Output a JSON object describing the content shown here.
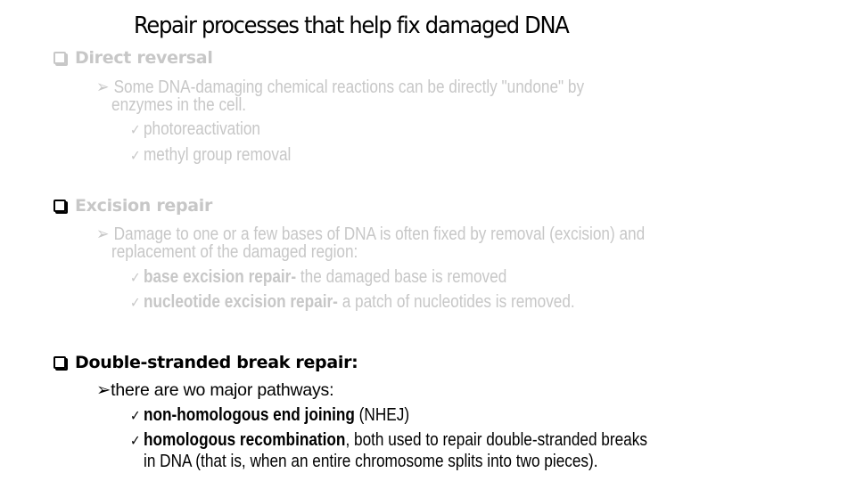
{
  "title": "Repair processes that help fix damaged DNA",
  "sections": [
    {
      "heading": "Direct reversal",
      "bullet": {
        "line1": "Some DNA-damaging chemical reactions can be directly \"undone\" by",
        "line2": "enzymes in the cell."
      },
      "items": [
        {
          "text": "photoreactivation"
        },
        {
          "text": "methyl group removal"
        }
      ]
    },
    {
      "heading": "Excision repair",
      "bullet": {
        "line1": "Damage to one or a few bases of DNA is often fixed by removal (excision) and",
        "line2": "replacement of the damaged region:"
      },
      "items": [
        {
          "bold": "base excision repair-",
          "text": " the damaged base is removed"
        },
        {
          "bold": "nucleotide excision repair-",
          "text": "  a patch of nucleotides is removed."
        }
      ]
    },
    {
      "heading": "Double-stranded break repair:",
      "bullet": {
        "line1": "there are wo major pathways:"
      },
      "items": [
        {
          "bold": "non-homologous end joining",
          "text": "  (NHEJ)"
        },
        {
          "bold": "homologous recombination",
          "text": ", both used to repair double-stranded breaks",
          "line2": "in DNA (that is, when an entire chromosome splits into two pieces)."
        }
      ]
    }
  ],
  "icons": {
    "box": "square-bullet-icon",
    "arrow": "arrow-bullet-icon",
    "check": "checkmark-icon"
  },
  "glyphs": {
    "arrow": "➢",
    "check": "✓"
  },
  "colors": {
    "faded": "#c7c7c7",
    "active": "#000000"
  }
}
